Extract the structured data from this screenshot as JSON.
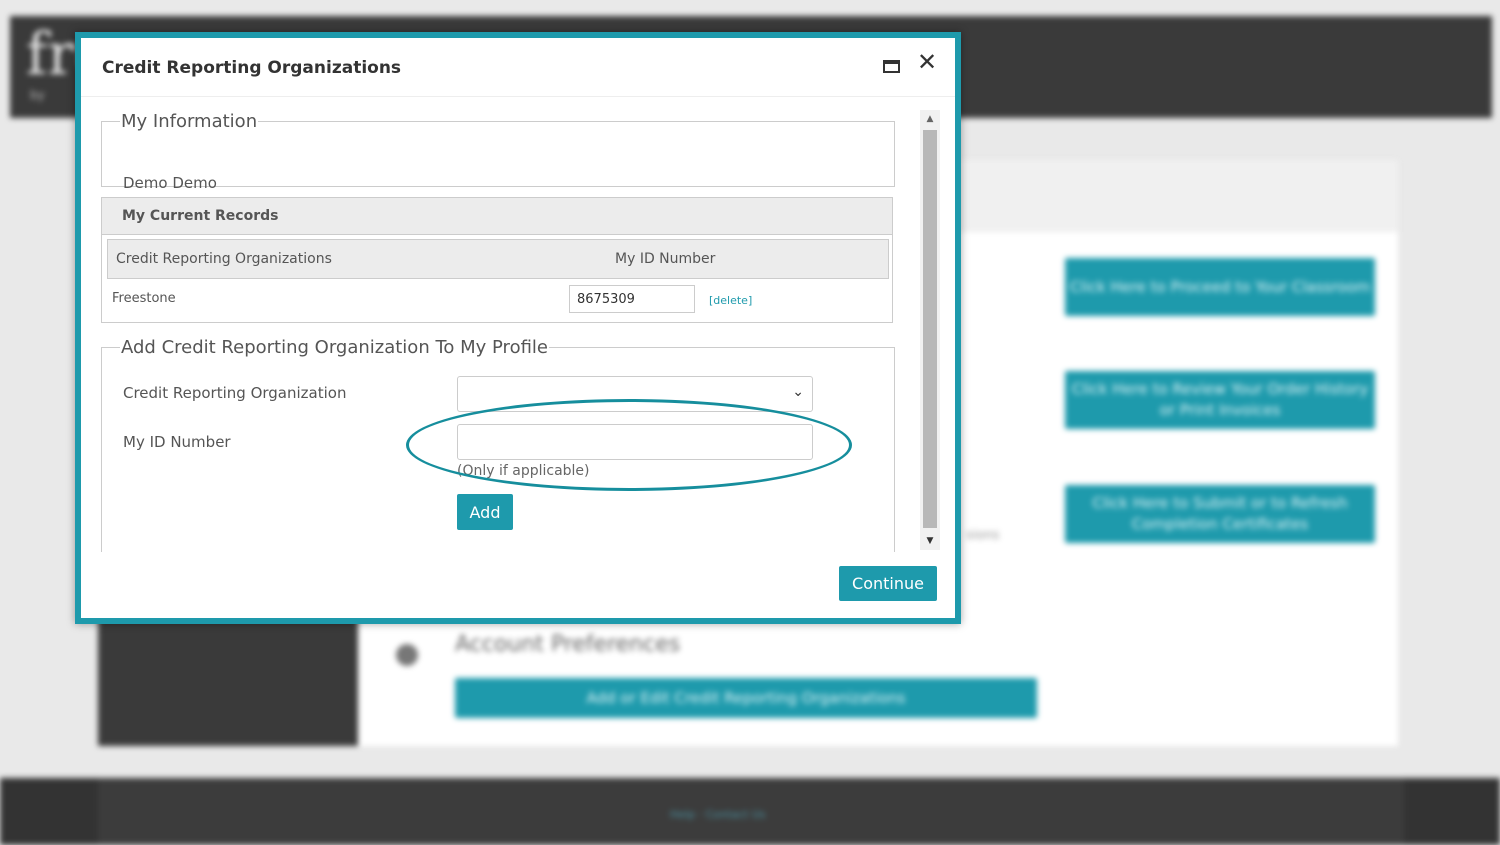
{
  "background": {
    "logo": "fre",
    "logo_sub": "by",
    "buttons": [
      "Click Here to Proceed to Your Classroom",
      "Click Here to Review Your Order History or Print Invoices",
      "Click Here to Submit or to Refresh Completion Certificates"
    ],
    "section_title": "Account Preferences",
    "wide_button": "Add or Edit Credit Reporting Organizations",
    "small_text": "sions",
    "footer_link": "Help · Contact Us"
  },
  "modal": {
    "title": "Credit Reporting Organizations",
    "my_information": {
      "legend": "My Information",
      "name": "Demo Demo"
    },
    "current_records": {
      "heading": "My Current Records",
      "columns": [
        "Credit Reporting Organizations",
        "My ID Number"
      ],
      "rows": [
        {
          "organization": "Freestone",
          "id_number": "8675309",
          "delete_label": "[delete]"
        }
      ]
    },
    "add_section": {
      "legend": "Add Credit Reporting Organization To My Profile",
      "org_label": "Credit Reporting Organization",
      "org_value": "",
      "id_label": "My ID Number",
      "id_value": "",
      "hint": "(Only if applicable)",
      "add_label": "Add"
    },
    "continue_label": "Continue"
  },
  "colors": {
    "accent": "#1e9aac",
    "annotation": "#168e9d"
  },
  "icons": [
    "maximize-icon",
    "close-icon",
    "chevron-down-icon",
    "scroll-up-icon",
    "scroll-down-icon"
  ]
}
